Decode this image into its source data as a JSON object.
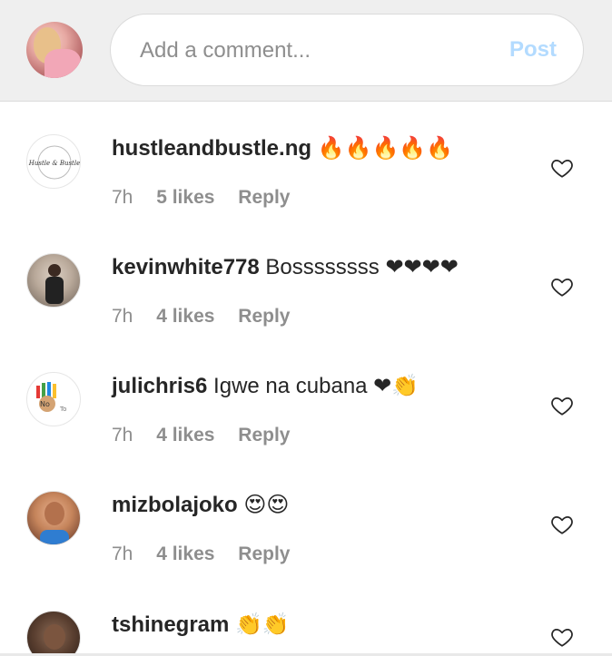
{
  "composer": {
    "placeholder": "Add a comment...",
    "post_label": "Post"
  },
  "comments": [
    {
      "username": "hustleandbustle.ng",
      "text": "🔥🔥🔥🔥🔥",
      "time": "7h",
      "likes": "5 likes",
      "reply": "Reply"
    },
    {
      "username": "kevinwhite778",
      "text": "Bossssssss ❤❤❤❤",
      "time": "7h",
      "likes": "4 likes",
      "reply": "Reply"
    },
    {
      "username": "julichris6",
      "text": "Igwe na cubana ❤👏",
      "time": "7h",
      "likes": "4 likes",
      "reply": "Reply"
    },
    {
      "username": "mizbolajoko",
      "text": "😍😍",
      "time": "7h",
      "likes": "4 likes",
      "reply": "Reply"
    },
    {
      "username": "tshinegram",
      "text": "👏👏",
      "time": "",
      "likes": "",
      "reply": ""
    }
  ],
  "avatar_texts": {
    "hustle_logo": "Hustle & Bustle"
  },
  "colors": {
    "post_disabled": "#b3dbff",
    "heart_emoji": "#ed4956",
    "secondary_text": "#8e8e8e"
  },
  "icons": {
    "like": "heart-outline-icon"
  }
}
